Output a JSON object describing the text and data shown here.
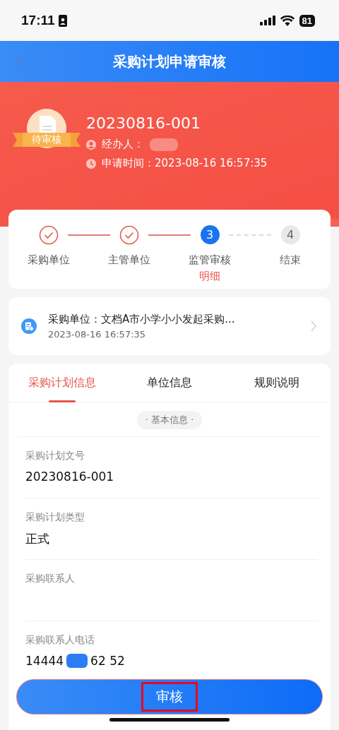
{
  "status_bar": {
    "time": "17:11",
    "battery": "81"
  },
  "header": {
    "title": "采购计划申请审核"
  },
  "summary": {
    "badge": "待审核",
    "number": "20230816-001",
    "handler_label": "经办人：",
    "handler_redacted": true,
    "time_label": "申请时间：",
    "time": "2023-08-16 16:57:35"
  },
  "steps": [
    {
      "label": "采购单位",
      "kind": "done"
    },
    {
      "label": "主管单位",
      "kind": "done"
    },
    {
      "label": "监管审核",
      "kind": "current",
      "number": "3",
      "link": "明细"
    },
    {
      "label": "结束",
      "kind": "pending",
      "number": "4"
    }
  ],
  "record": {
    "title": "采购单位：文档A市小学小小发起采购...",
    "time": "2023-08-16 16:57:35"
  },
  "tabs": [
    {
      "label": "采购计划信息",
      "selected": true
    },
    {
      "label": "单位信息",
      "selected": false
    },
    {
      "label": "规则说明",
      "selected": false
    }
  ],
  "section_title": "· 基本信息 ·",
  "fields": [
    {
      "label": "采购计划文号",
      "value": "20230816-001"
    },
    {
      "label": "采购计划类型",
      "value": "正式"
    },
    {
      "label": "采购联系人"
    },
    {
      "label": "采购联系人电话",
      "value": "14444",
      "value_tail": "62 52",
      "redacted": true
    }
  ],
  "action_button": {
    "label": "审核",
    "highlighted": true
  }
}
